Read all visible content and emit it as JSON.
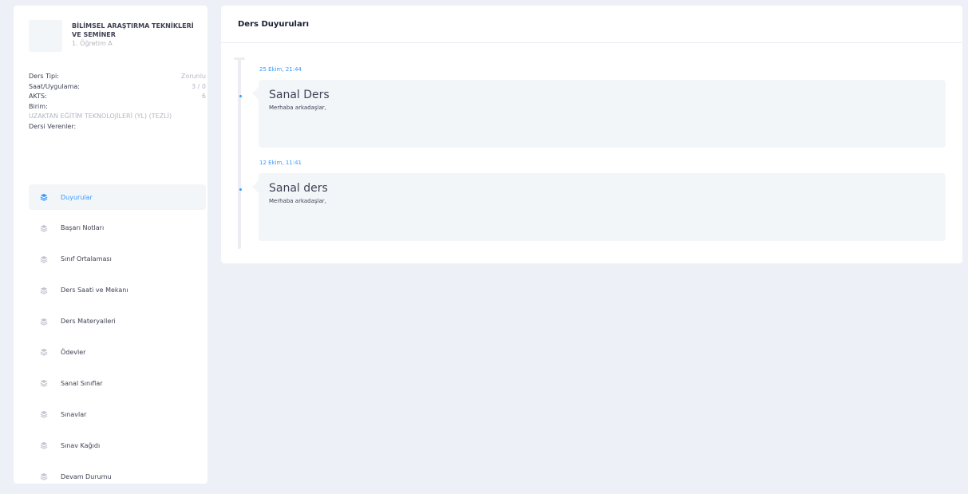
{
  "course": {
    "name": "BİLİMSEL ARAŞTIRMA TEKNİKLERİ VE SEMİNER",
    "section": "1. Öğretim A"
  },
  "info": {
    "type_label": "Ders Tipi:",
    "type_value": "Zorunlu",
    "hours_label": "Saat/Uygulama:",
    "hours_value": "3 / 0",
    "ects_label": "AKTS:",
    "ects_value": "6",
    "unit_label": "Birim:",
    "unit_value": "UZAKTAN EĞİTİM TEKNOLOJİLERİ (YL) (TEZLİ)",
    "instructors_label": "Dersi Verenler:"
  },
  "nav": {
    "items": [
      {
        "label": "Duyurular"
      },
      {
        "label": "Başarı Notları"
      },
      {
        "label": "Sınıf Ortalaması"
      },
      {
        "label": "Ders Saati ve Mekanı"
      },
      {
        "label": "Ders Materyalleri"
      },
      {
        "label": "Ödevler"
      },
      {
        "label": "Sanal Sınıflar"
      },
      {
        "label": "Sınavlar"
      },
      {
        "label": "Sınav Kağıdı"
      },
      {
        "label": "Devam Durumu"
      }
    ],
    "active_index": 0,
    "icon": "layers-icon"
  },
  "main": {
    "title": "Ders Duyuruları",
    "announcements": [
      {
        "date": "25 Ekim, 21:44",
        "title": "Sanal Ders",
        "text": "Merhaba arkadaşlar,"
      },
      {
        "date": "12 Ekim, 11:41",
        "title": "Sanal ders",
        "text": "Merhaba arkadaşlar,"
      }
    ]
  },
  "colors": {
    "accent": "#3699ff",
    "background": "#eef0f7",
    "muted": "#b5b5c3"
  }
}
